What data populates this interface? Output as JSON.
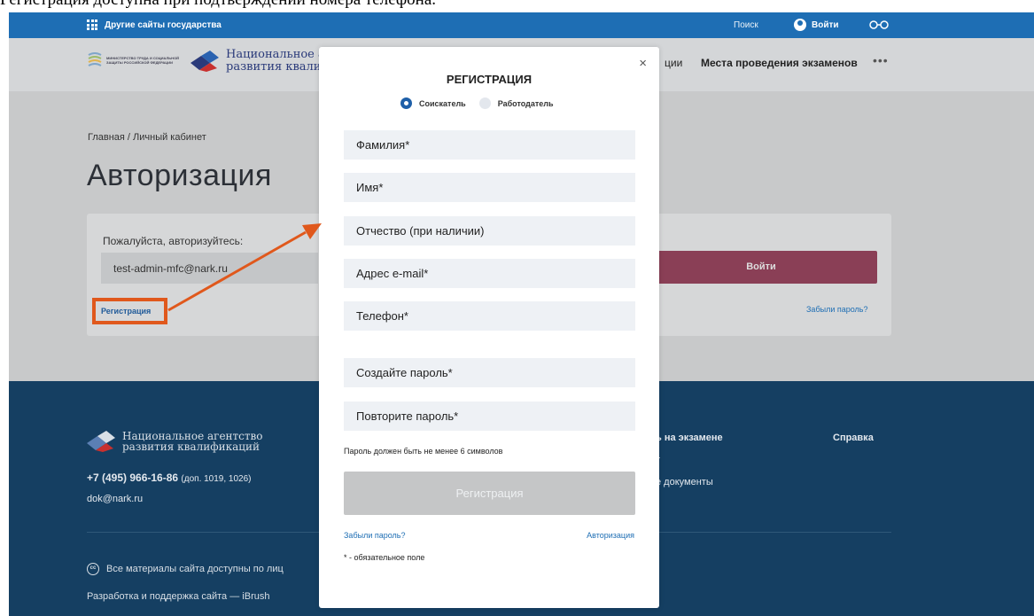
{
  "caption": "Регистрация доступна при подтверждении номера телефона.",
  "gov_bar": {
    "other_sites": "Другие сайты государства",
    "search": "Поиск",
    "login": "Войти"
  },
  "header": {
    "ministry_text": "МИНИСТЕРСТВО ТРУДА И СОЦИАЛЬНОЙ ЗАЩИТЫ РОССИЙСКОЙ ФЕДЕРАЦИИ",
    "nark_line1": "Национальное а",
    "nark_line2": "развития квали",
    "nav_partial": "ции",
    "nav_exam_places": "Места проведения экзаменов",
    "more": "•••"
  },
  "main": {
    "breadcrumb": "Главная / Личный кабинет",
    "title": "Авторизация",
    "prompt": "Пожалуйста, авторизуйтесь:",
    "email_value": "test-admin-mfc@nark.ru",
    "login_button": "Войти",
    "registration_link": "Регистрация",
    "forgot_link": "Забыли пароль?"
  },
  "footer": {
    "logo_line1": "Национальное агентство",
    "logo_line2": "развития квалификаций",
    "phone": "+7 (495) 966-16-86",
    "phone_ext": "(доп. 1019, 1026)",
    "email": "dok@nark.ru",
    "col_exam": "ь на экзамене",
    "col_t": "т",
    "col_docs": "е документы",
    "help": "Справка",
    "cc_text": "Все материалы сайта доступны по лиц",
    "dev": "Разработка и поддержка сайта — iBrush"
  },
  "modal": {
    "close": "×",
    "title": "РЕГИСТРАЦИЯ",
    "role_seeker": "Соискатель",
    "role_employer": "Работодатель",
    "fields": [
      "Фамилия*",
      "Имя*",
      "Отчество (при наличии)",
      "Адрес e-mail*",
      "Телефон*",
      "Создайте пароль*",
      "Повторите пароль*"
    ],
    "password_hint": "Пароль должен быть не менее 6 символов",
    "register_button": "Регистрация",
    "forgot_link": "Забыли пароль?",
    "auth_link": "Авторизация",
    "required_note": "* - обязательное поле"
  },
  "colors": {
    "gov_bar": "#1e6eb4",
    "footer": "#153f62",
    "login_button": "#8a3f56",
    "annotation": "#e0581c"
  }
}
